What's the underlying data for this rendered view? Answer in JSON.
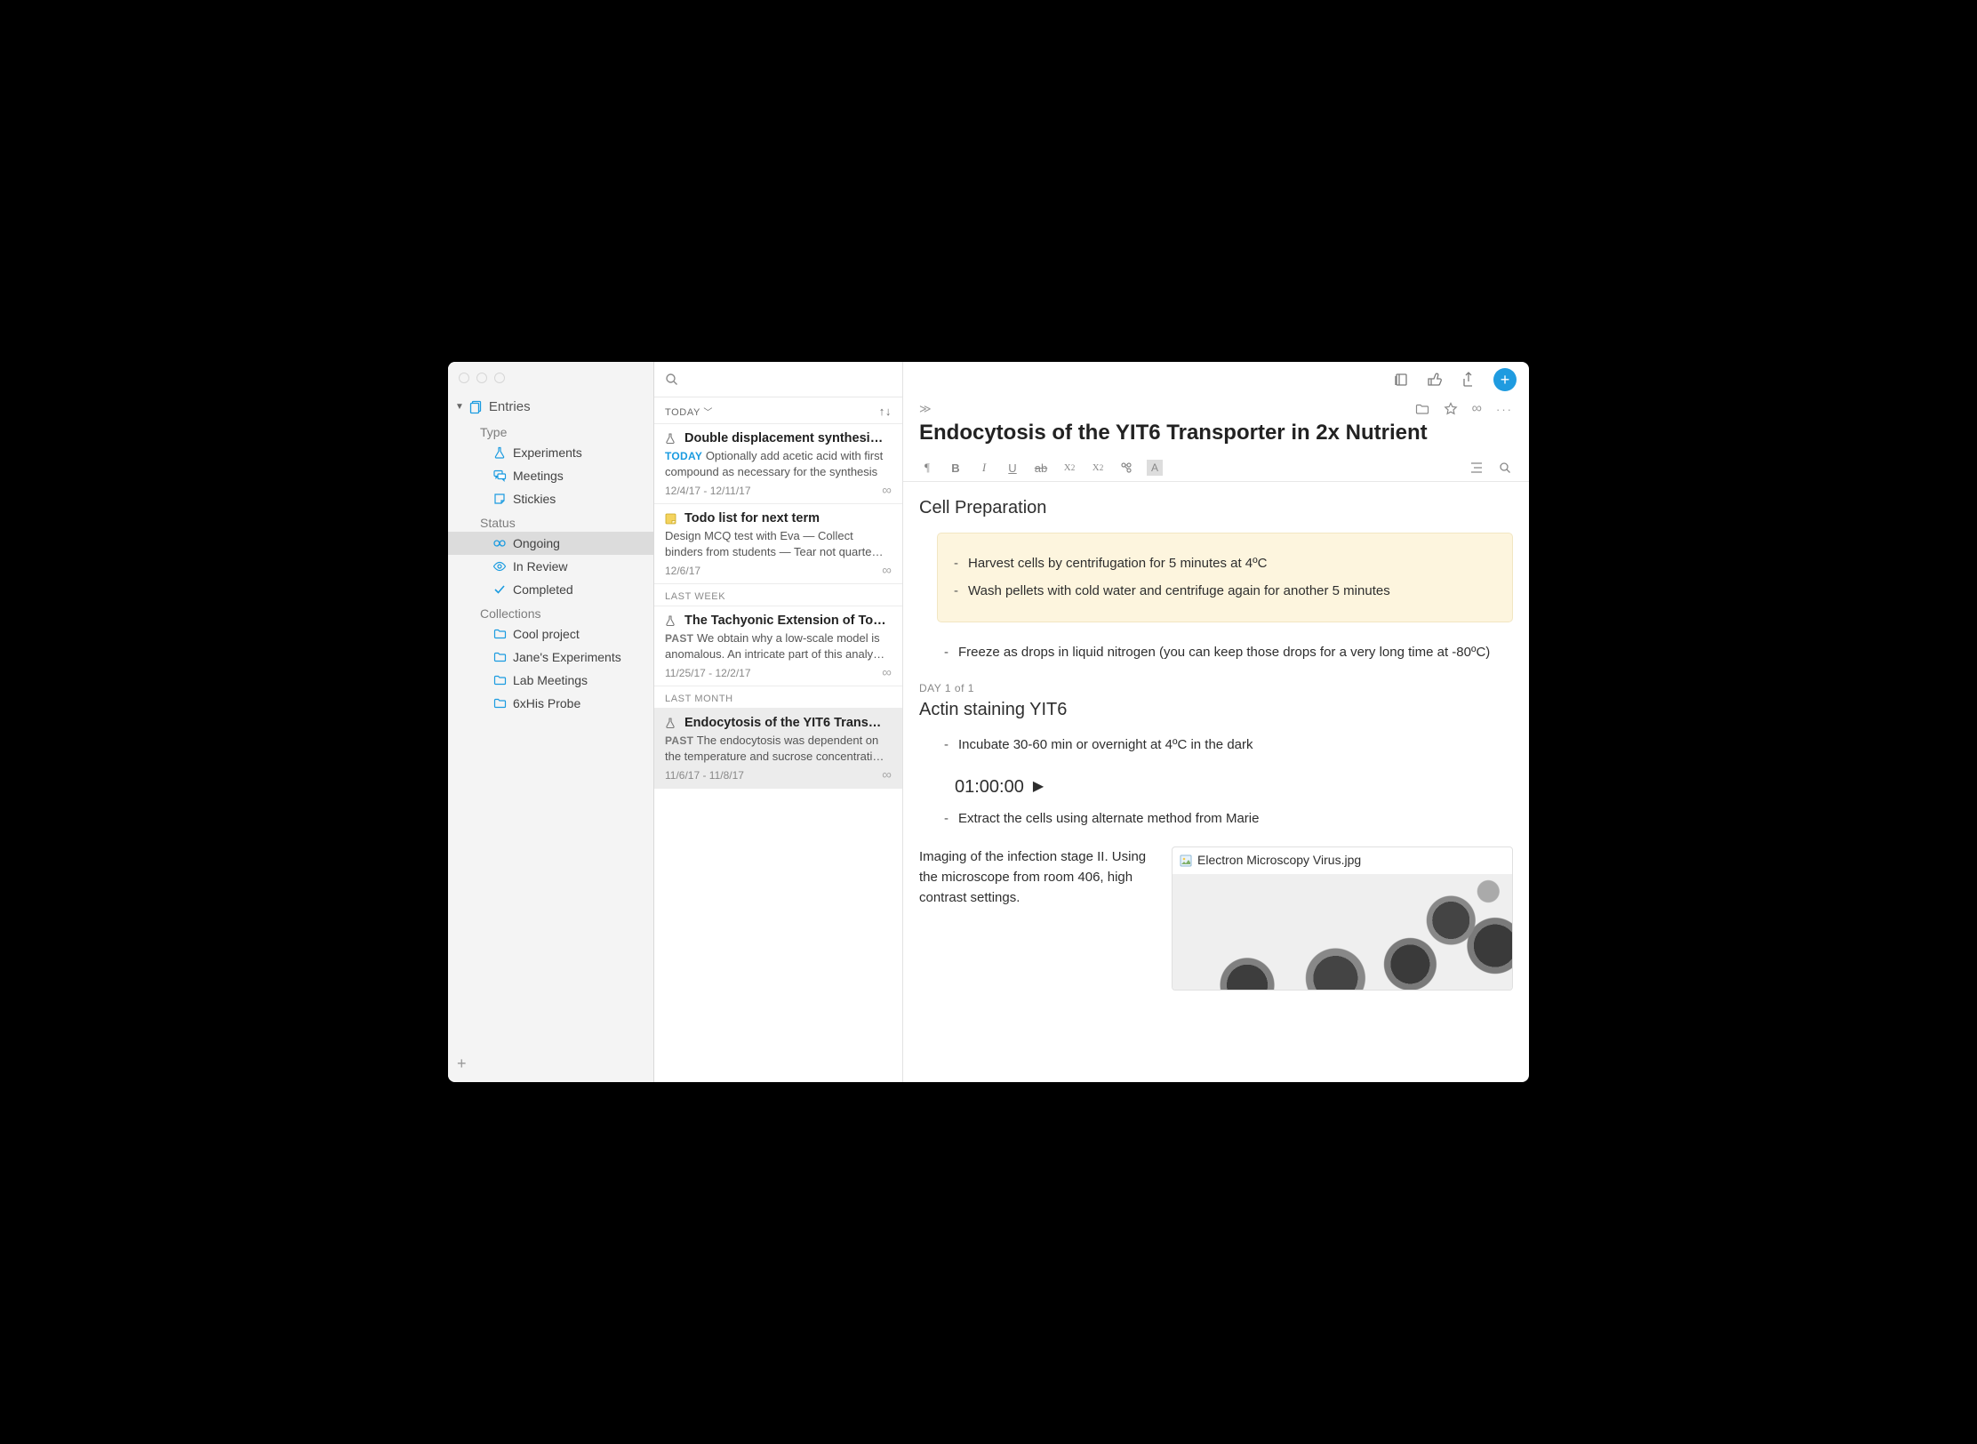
{
  "sidebar": {
    "root": "Entries",
    "sections": [
      {
        "label": "Type",
        "items": [
          {
            "icon": "flask",
            "label": "Experiments"
          },
          {
            "icon": "chat",
            "label": "Meetings"
          },
          {
            "icon": "note",
            "label": "Stickies"
          }
        ]
      },
      {
        "label": "Status",
        "items": [
          {
            "icon": "infinity",
            "label": "Ongoing",
            "selected": true
          },
          {
            "icon": "eye",
            "label": "In Review"
          },
          {
            "icon": "check",
            "label": "Completed"
          }
        ]
      },
      {
        "label": "Collections",
        "items": [
          {
            "icon": "folder",
            "label": "Cool project"
          },
          {
            "icon": "folder",
            "label": "Jane's Experiments"
          },
          {
            "icon": "folder",
            "label": "Lab Meetings"
          },
          {
            "icon": "folder",
            "label": "6xHis Probe"
          }
        ]
      }
    ]
  },
  "list": {
    "filter": "TODAY",
    "groups": [
      {
        "header": null,
        "entries": [
          {
            "icon": "flask",
            "title": "Double displacement synthesi…",
            "tag": "TODAY",
            "tagClass": "today",
            "desc": "Optionally add acetic acid with first compound as necessary for the synthesis",
            "date": "12/4/17 - 12/11/17"
          },
          {
            "icon": "sticky",
            "title": "Todo list for next term",
            "tag": null,
            "desc": "Design MCQ test with Eva — Collect binders from students — Tear not quarte…",
            "date": "12/6/17"
          }
        ]
      },
      {
        "header": "LAST WEEK",
        "entries": [
          {
            "icon": "flask",
            "title": "The Tachyonic Extension of To…",
            "tag": "PAST",
            "tagClass": "past",
            "desc": "We obtain why a low-scale model is anomalous. An intricate part of this analy…",
            "date": "11/25/17 - 12/2/17"
          }
        ]
      },
      {
        "header": "LAST MONTH",
        "entries": [
          {
            "icon": "flask",
            "title": "Endocytosis of the YIT6 Trans…",
            "tag": "PAST",
            "tagClass": "past",
            "desc": "The endocytosis was dependent on the temperature and sucrose concentrati…",
            "date": "11/6/17 - 11/8/17",
            "selected": true
          }
        ]
      }
    ]
  },
  "doc": {
    "title": "Endocytosis of the YIT6 Transporter in 2x Nutrient",
    "h_cell": "Cell Preparation",
    "callout1": "Harvest cells by centrifugation for 5 minutes at 4ºC",
    "callout2": "Wash pellets with cold water and centrifuge again for another 5 minutes",
    "bullet1": "Freeze as drops in liquid nitrogen (you can keep those drops for a very long time at -80ºC)",
    "day": "DAY 1 of 1",
    "h_actin": "Actin staining YIT6",
    "b_actin1": "Incubate 30-60 min or overnight at 4ºC in the dark",
    "timer": "01:00:00",
    "b_actin2": "Extract the cells using alternate method from Marie",
    "imaging": "Imaging of the infection stage II. Using the microscope from room 406, high contrast settings.",
    "attachment": "Electron Microscopy Virus.jpg"
  }
}
